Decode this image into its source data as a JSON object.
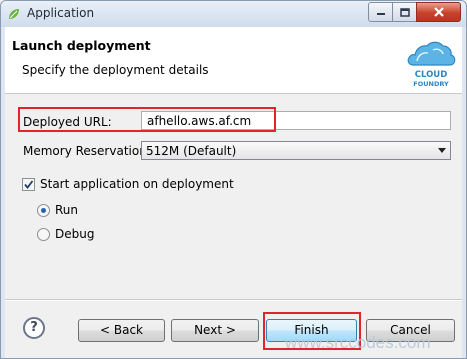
{
  "window": {
    "title": "Application",
    "icons": {
      "app": "spring-leaf-icon",
      "minimize": "minimize-icon",
      "maximize": "maximize-icon",
      "close": "close-icon"
    }
  },
  "header": {
    "title": "Launch deployment",
    "description": "Specify the deployment details",
    "logo_text_1": "CLOUD",
    "logo_text_2": "FOUNDRY"
  },
  "form": {
    "deployed_url_label": "Deployed URL:",
    "deployed_url_value": "afhello.aws.af.cm",
    "memory_label": "Memory Reservation:",
    "memory_value": "512M (Default)",
    "start_checkbox_label": "Start application on deployment",
    "start_checked": true,
    "mode_options": [
      {
        "label": "Run",
        "selected": true
      },
      {
        "label": "Debug",
        "selected": false
      }
    ]
  },
  "buttons": {
    "help": "?",
    "back": "< Back",
    "next": "Next >",
    "finish": "Finish",
    "cancel": "Cancel"
  },
  "watermark": "www.srccodes.com",
  "colors": {
    "highlight": "#e0252b",
    "accent": "#2760b9",
    "logo": "#3a9ad9"
  }
}
